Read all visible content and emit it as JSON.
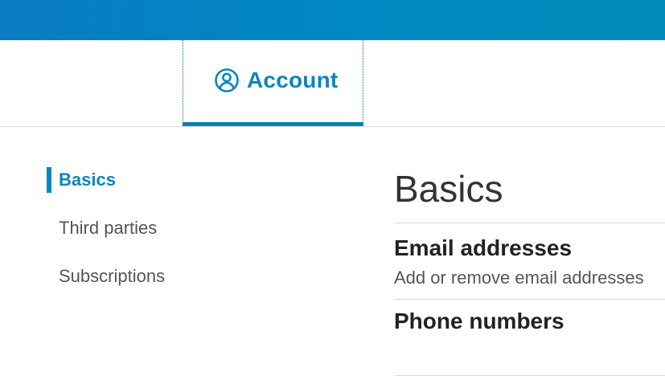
{
  "tabs": {
    "account_label": "Account"
  },
  "sidebar": {
    "items": [
      {
        "label": "Basics",
        "active": true
      },
      {
        "label": "Third parties",
        "active": false
      },
      {
        "label": "Subscriptions",
        "active": false
      }
    ]
  },
  "main": {
    "title": "Basics",
    "sections": [
      {
        "title": "Email addresses",
        "description": "Add or remove email addresses"
      },
      {
        "title": "Phone numbers"
      }
    ]
  },
  "colors": {
    "accent": "#0a86bf",
    "top_bar": "#0089c2"
  },
  "icons": {
    "account_tab": "user-circle-icon"
  }
}
